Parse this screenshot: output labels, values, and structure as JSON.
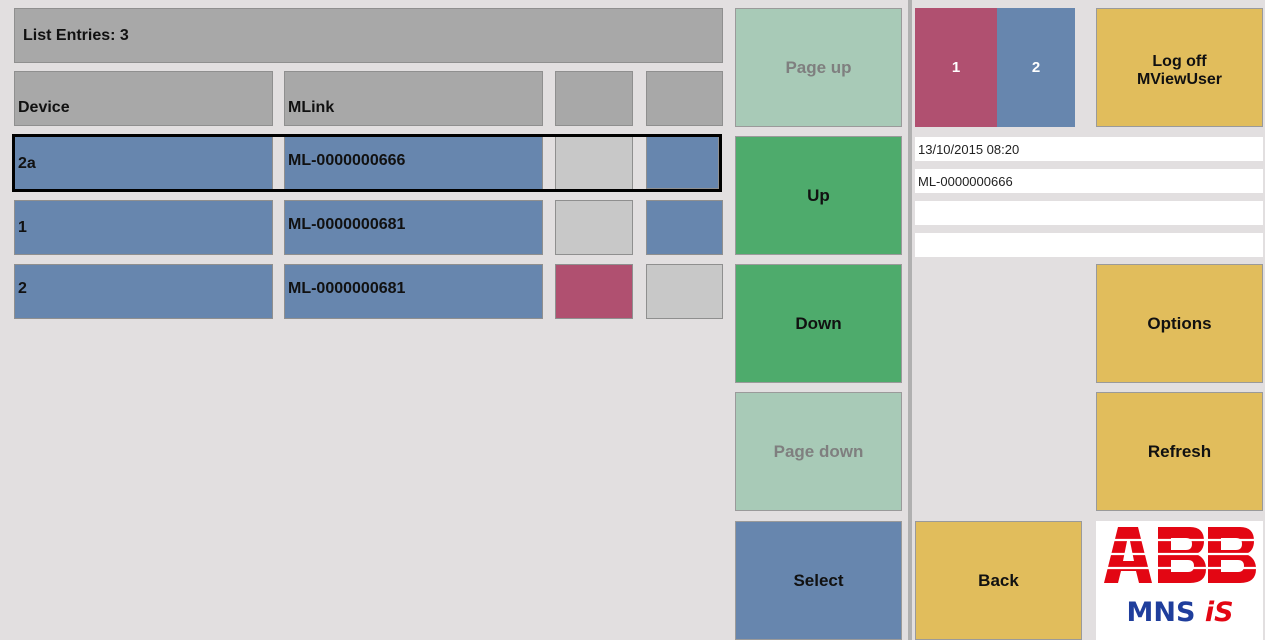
{
  "list": {
    "entries_label": "List Entries:  3",
    "headers": {
      "device": "Device",
      "mlink": "MLink"
    },
    "rows": [
      {
        "device": "2a",
        "mlink": "ML-0000000666"
      },
      {
        "device": "1",
        "mlink": "ML-0000000681"
      },
      {
        "device": "2",
        "mlink": "ML-0000000681"
      }
    ]
  },
  "nav": {
    "page_up": "Page up",
    "up": "Up",
    "down": "Down",
    "page_down": "Page down",
    "select": "Select"
  },
  "right": {
    "tab1": "1",
    "tab2": "2",
    "logoff_line1": "Log off",
    "logoff_line2": "MViewUser",
    "datetime": "13/10/2015 08:20",
    "mlink": "ML-0000000666",
    "options": "Options",
    "refresh": "Refresh",
    "back": "Back"
  },
  "logo": {
    "brand": "ABB",
    "product_a": "MNS",
    "product_b": "iS"
  },
  "colors": {
    "blue": "#6786ae",
    "pink": "#b05070",
    "green": "#4eab6c",
    "yellow": "#e1bd5c",
    "logo_red": "#e30613",
    "logo_blue": "#1f3e9c"
  }
}
